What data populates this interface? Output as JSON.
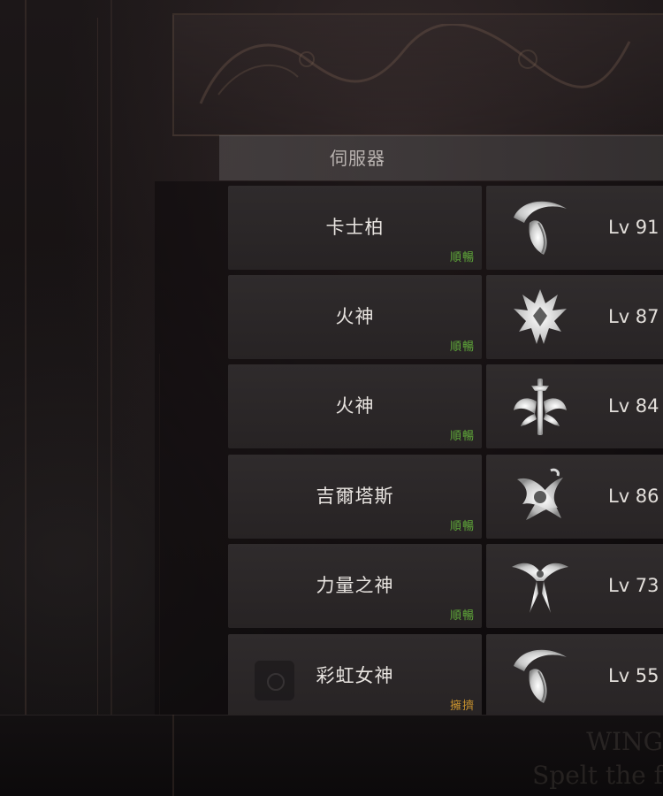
{
  "header": {
    "label": "伺服器"
  },
  "background": {
    "watermark_lines": "WING\nSpelt the f"
  },
  "rows": [
    {
      "server": "卡士柏",
      "status": "順暢",
      "status_color": "#5fa83a",
      "level": "Lv 91",
      "class_icon": "scythe-icon"
    },
    {
      "server": "火神",
      "status": "順暢",
      "status_color": "#5fa83a",
      "level": "Lv 87",
      "class_icon": "crown-spikes-icon"
    },
    {
      "server": "火神",
      "status": "順暢",
      "status_color": "#5fa83a",
      "level": "Lv 84",
      "class_icon": "sword-wings-icon"
    },
    {
      "server": "吉爾塔斯",
      "status": "順暢",
      "status_color": "#5fa83a",
      "level": "Lv 86",
      "class_icon": "swirl-emblem-icon"
    },
    {
      "server": "力量之神",
      "status": "順暢",
      "status_color": "#5fa83a",
      "level": "Lv 73",
      "class_icon": "winged-blade-icon"
    },
    {
      "server": "彩虹女神",
      "status": "擁擠",
      "status_color": "#c8922e",
      "level": "Lv 55",
      "class_icon": "scythe-icon"
    }
  ]
}
